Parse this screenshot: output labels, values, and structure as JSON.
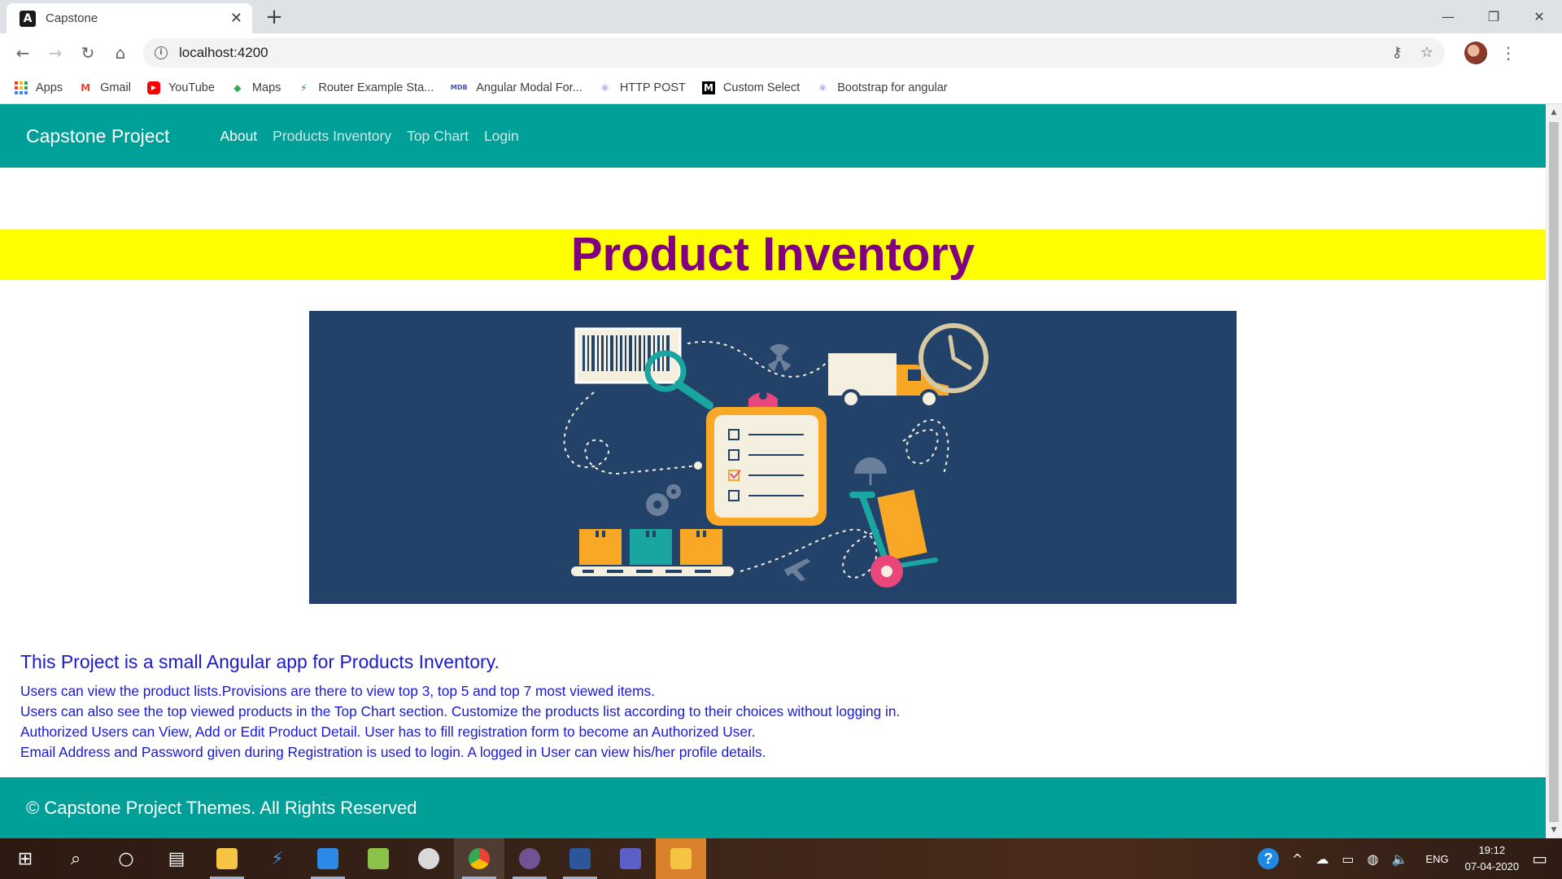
{
  "browser": {
    "tab_title": "Capstone",
    "tab_favicon": "angular-icon",
    "url": "localhost:4200",
    "bookmarks": [
      {
        "label": "Apps",
        "icon": "apps-grid-icon"
      },
      {
        "label": "Gmail",
        "icon": "gmail-icon"
      },
      {
        "label": "YouTube",
        "icon": "youtube-icon"
      },
      {
        "label": "Maps",
        "icon": "maps-icon"
      },
      {
        "label": "Router Example Sta...",
        "icon": "lightning-icon"
      },
      {
        "label": "Angular Modal For...",
        "icon": "mdb-icon"
      },
      {
        "label": "HTTP POST",
        "icon": "react-icon"
      },
      {
        "label": "Custom Select",
        "icon": "medium-icon"
      },
      {
        "label": "Bootstrap for angular",
        "icon": "react-icon"
      }
    ]
  },
  "app": {
    "brand": "Capstone Project",
    "nav": [
      {
        "label": "About",
        "active": true
      },
      {
        "label": "Products Inventory",
        "active": false
      },
      {
        "label": "Top Chart",
        "active": false
      },
      {
        "label": "Login",
        "active": false
      }
    ],
    "hero_title": "Product Inventory",
    "intro_heading": "This Project is a small Angular app for Products Inventory.",
    "intro_lines": [
      "Users can view the product lists.Provisions are there to view top 3, top 5 and top 7 most viewed items.",
      "Users can also see the top viewed products in the Top Chart section. Customize the products list according to their choices without logging in.",
      "Authorized Users can View, Add or Edit Product Detail. User has to fill registration form to become an Authorized User.",
      "Email Address and Password given during Registration is used to login. A logged in User can view his/her profile details."
    ],
    "footer_text": "© Capstone Project Themes. All Rights Reserved",
    "colors": {
      "navbar": "#009f98",
      "hero_bg": "#ffff00",
      "hero_text": "#800080",
      "intro_text": "#1a1ad0",
      "banner_bg": "#224269"
    }
  },
  "taskbar": {
    "language": "ENG",
    "time": "19:12",
    "date": "07-04-2020"
  }
}
